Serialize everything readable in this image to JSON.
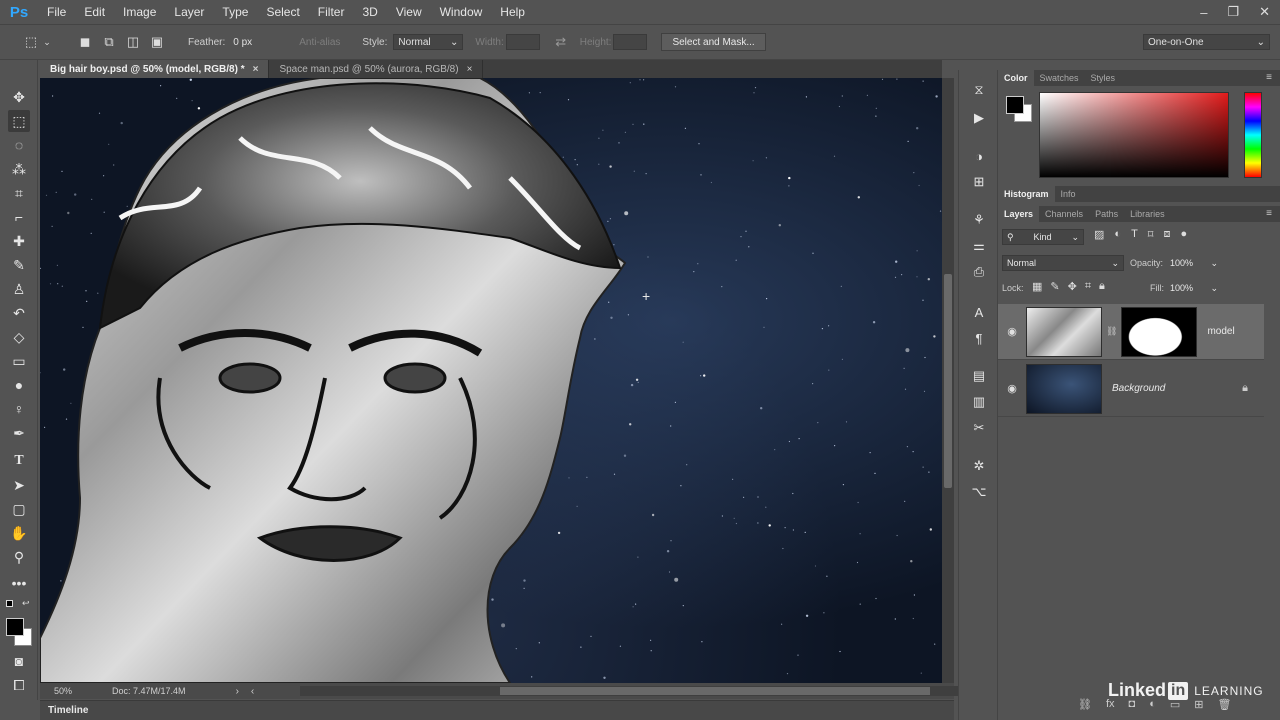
{
  "app": {
    "logo": "Ps"
  },
  "menu": [
    "File",
    "Edit",
    "Image",
    "Layer",
    "Type",
    "Select",
    "Filter",
    "3D",
    "View",
    "Window",
    "Help"
  ],
  "window_controls": [
    "–",
    "❐",
    "✕"
  ],
  "options": {
    "feather_label": "Feather:",
    "feather_value": "0 px",
    "antialias_label": "Anti-alias",
    "style_label": "Style:",
    "style_value": "Normal",
    "width_label": "Width:",
    "height_label": "Height:",
    "select_mask_button": "Select and Mask...",
    "workspace": "One-on-One"
  },
  "tabs": [
    {
      "label": "Big hair boy.psd @ 50% (model, RGB/8) *",
      "close": "×"
    },
    {
      "label": "Space man.psd @ 50% (aurora, RGB/8)",
      "close": "×"
    }
  ],
  "status": {
    "zoom": "50%",
    "doc": "Doc: 7.47M/17.4M"
  },
  "timeline_label": "Timeline",
  "color_panel": {
    "tabs": [
      "Color",
      "Swatches",
      "Styles"
    ],
    "accent": "#e21b1b"
  },
  "histogram_panel": {
    "tabs": [
      "Histogram",
      "Info"
    ]
  },
  "layers_panel": {
    "tabs": [
      "Layers",
      "Channels",
      "Paths",
      "Libraries"
    ],
    "filter_kind": "Kind",
    "blend_mode": "Normal",
    "opacity_label": "Opacity:",
    "opacity_value": "100%",
    "lock_label": "Lock:",
    "fill_label": "Fill:",
    "fill_value": "100%",
    "layers": [
      {
        "name": "model",
        "visible": true,
        "selected": true,
        "has_mask": true
      },
      {
        "name": "Background",
        "visible": true,
        "locked": true
      }
    ]
  },
  "watermark": {
    "brand": "Linked",
    "in": "in",
    "learning": "LEARNING"
  }
}
